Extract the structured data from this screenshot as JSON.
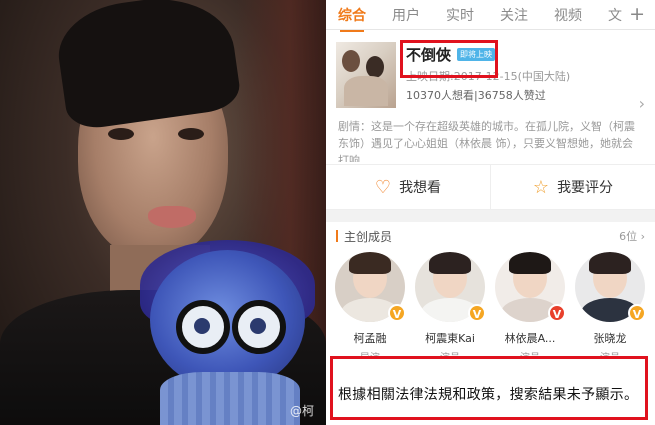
{
  "photo": {
    "watermark": "@柯"
  },
  "tabs": {
    "items": [
      "综合",
      "用户",
      "实时",
      "关注",
      "视频",
      "文"
    ],
    "active_index": 0,
    "add_icon": "plus-icon"
  },
  "movie": {
    "title": "不倒俠",
    "badge": "即将上映",
    "release_date": "上映日期:2017-12-15(中国大陆)",
    "stats": "10370人想看|36758人赞过",
    "synopsis": "剧情：这是一个存在超级英雄的城市。在孤儿院，义智（柯震东饰）遇见了心心姐姐（林依晨 饰），只要义智想她，她就会打响..."
  },
  "actions": {
    "want_label": "我想看",
    "rate_label": "我要评分"
  },
  "cast": {
    "title": "主创成员",
    "count": "6位",
    "members": [
      {
        "name": "柯孟融",
        "role": "导演",
        "badge": "V"
      },
      {
        "name": "柯震東Kai",
        "role": "演员",
        "badge": "V"
      },
      {
        "name": "林依晨A...",
        "role": "演员",
        "badge": "V"
      },
      {
        "name": "张晓龙",
        "role": "演员",
        "badge": "V"
      }
    ]
  },
  "notice": {
    "text": "根據相關法律法規和政策，搜索結果未予顯示。"
  },
  "colors": {
    "accent": "#f07a1a",
    "highlight_box": "#e0121e"
  }
}
